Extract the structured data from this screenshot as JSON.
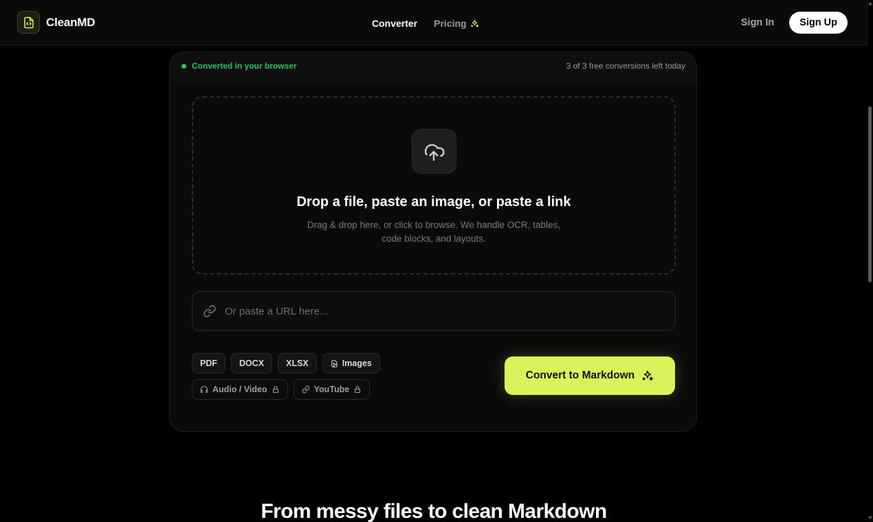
{
  "header": {
    "brand": "CleanMD",
    "nav": [
      {
        "label": "Converter",
        "active": true
      },
      {
        "label": "Pricing",
        "icon": "sparkles-icon"
      }
    ],
    "signin_label": "Sign In",
    "signup_label": "Sign Up"
  },
  "converter": {
    "status_text": "Converted in your browser",
    "quota_text": "3 of 3 free conversions left today",
    "drop_title": "Drop a file, paste an image, or paste a link",
    "drop_subtitle": "Drag & drop here, or click to browse. We handle OCR, tables, code blocks, and layouts.",
    "url_placeholder": "Or paste a URL here...",
    "url_value": "",
    "formats": [
      "PDF",
      "DOCX",
      "XLSX",
      "Images"
    ],
    "locked_formats": [
      "Audio / Video",
      "YouTube"
    ],
    "convert_label": "Convert to Markdown"
  },
  "section": {
    "title": "From messy files to clean Markdown"
  },
  "colors": {
    "accent": "#d9f35a",
    "status_green": "#22c55e",
    "background": "#000000"
  }
}
